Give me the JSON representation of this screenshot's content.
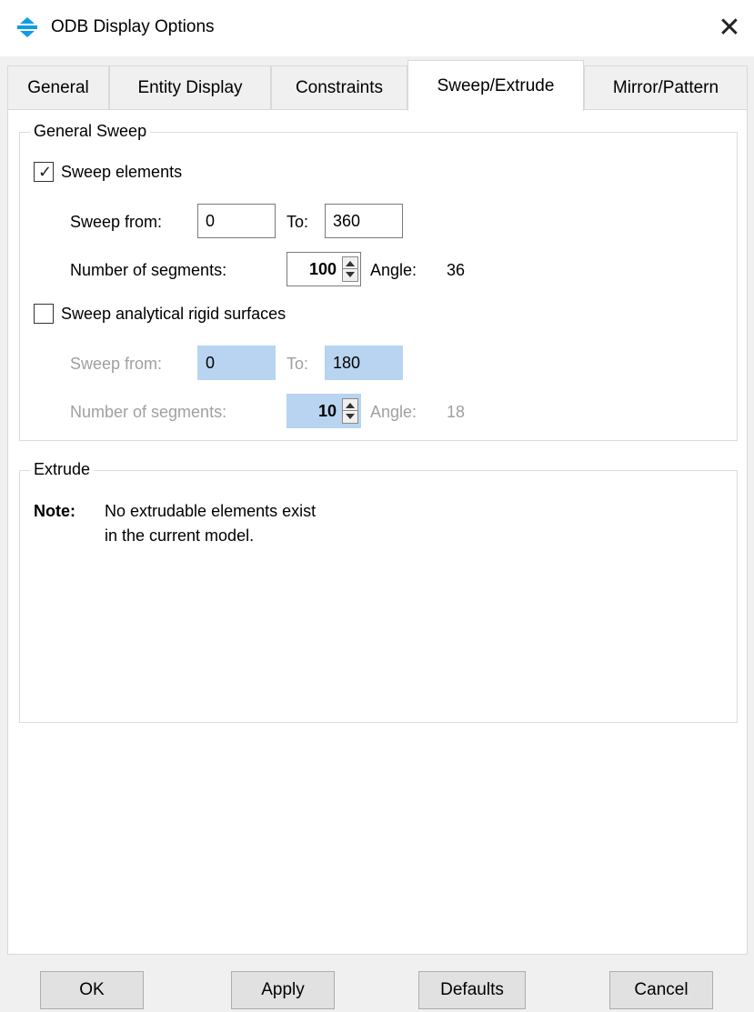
{
  "window": {
    "title": "ODB Display Options",
    "close_label": "✕"
  },
  "tabs": [
    {
      "label": "General"
    },
    {
      "label": "Entity Display"
    },
    {
      "label": "Constraints"
    },
    {
      "label": "Sweep/Extrude",
      "active": true
    },
    {
      "label": "Mirror/Pattern"
    }
  ],
  "general_sweep": {
    "title": "General Sweep",
    "sweep_elements": {
      "label": "Sweep elements",
      "checked": true,
      "from_label": "Sweep from:",
      "from_value": "0",
      "to_label": "To:",
      "to_value": "360",
      "segments_label": "Number of segments:",
      "segments_value": "100",
      "angle_label": "Angle:",
      "angle_value": "36"
    },
    "sweep_rigid": {
      "label": "Sweep analytical rigid surfaces",
      "checked": false,
      "from_label": "Sweep from:",
      "from_value": "0",
      "to_label": "To:",
      "to_value": "180",
      "segments_label": "Number of segments:",
      "segments_value": "10",
      "angle_label": "Angle:",
      "angle_value": "18"
    }
  },
  "extrude": {
    "title": "Extrude",
    "note_label": "Note:",
    "note_line1": "No extrudable elements exist",
    "note_line2": "in the current model."
  },
  "buttons": {
    "ok": "OK",
    "apply": "Apply",
    "defaults": "Defaults",
    "cancel": "Cancel"
  },
  "colors": {
    "selection": "#b8d4f0",
    "disabled_text": "#a0a0a0",
    "accent_icon": "#0e9de6"
  }
}
